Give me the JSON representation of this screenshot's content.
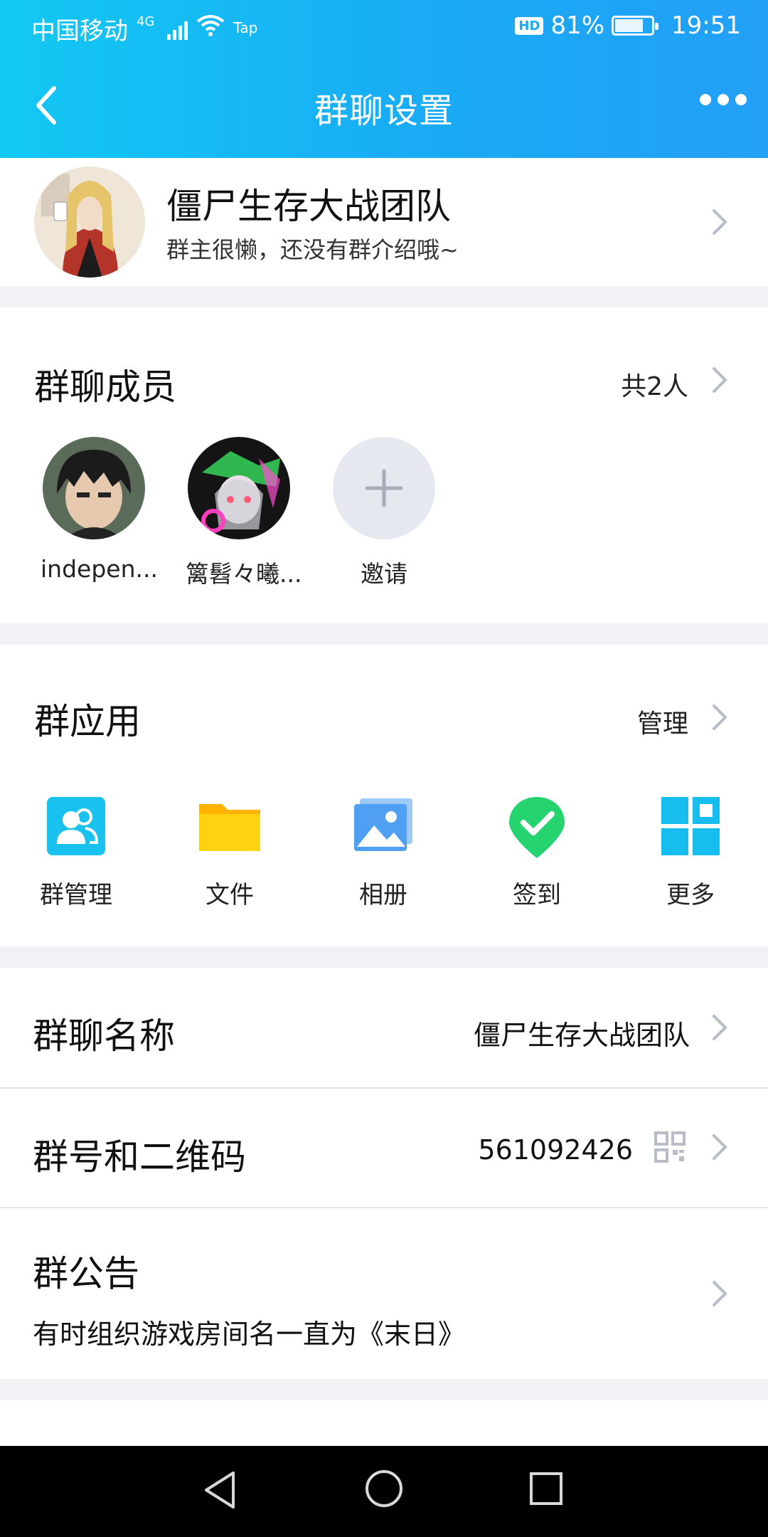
{
  "status": {
    "carrier": "中国移动",
    "network": "4G",
    "app_tag": "Tap",
    "hd": "HD",
    "battery": "81%",
    "battery_level": 0.81,
    "time": "19:51"
  },
  "header": {
    "title": "群聊设置",
    "back_icon": "chevron-left-icon",
    "more_icon": "more-icon"
  },
  "group": {
    "name": "僵尸生存大战团队",
    "description": "群主很懒，还没有群介绍哦~"
  },
  "members": {
    "title": "群聊成员",
    "count_label": "共2人",
    "items": [
      {
        "name": "indepen..."
      },
      {
        "name": "篱髫々曦..."
      },
      {
        "name": "邀请"
      }
    ]
  },
  "apps": {
    "title": "群应用",
    "manage_label": "管理",
    "items": [
      {
        "label": "群管理",
        "icon": "group-manage-icon",
        "color": "#19c2ee"
      },
      {
        "label": "文件",
        "icon": "folder-icon",
        "color": "#ffc40a"
      },
      {
        "label": "相册",
        "icon": "photo-album-icon",
        "color": "#5ea7f3"
      },
      {
        "label": "签到",
        "icon": "check-in-icon",
        "color": "#25d36f"
      },
      {
        "label": "更多",
        "icon": "grid-more-icon",
        "color": "#18bdf0"
      }
    ]
  },
  "settings": {
    "name_label": "群聊名称",
    "name_value": "僵尸生存大战团队",
    "number_label": "群号和二维码",
    "number_value": "561092426",
    "notice_label": "群公告",
    "notice_value": "有时组织游戏房间名一直为《末日》"
  },
  "theme": {
    "header_gradient_start": "#13c8f3",
    "header_gradient_end": "#23a0f6",
    "background": "#f1f2f6"
  }
}
